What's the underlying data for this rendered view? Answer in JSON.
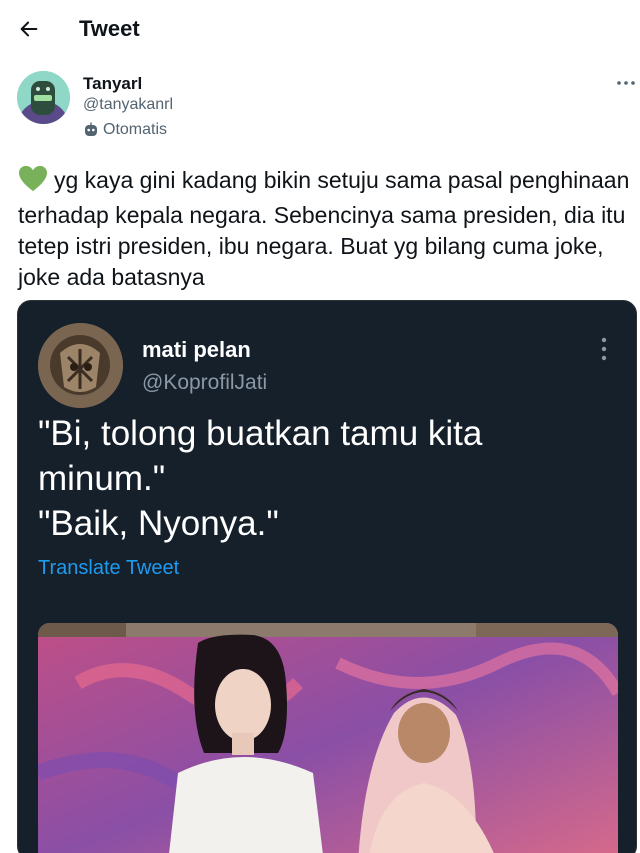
{
  "header": {
    "title": "Tweet",
    "back_icon": "arrow-left-icon"
  },
  "author": {
    "name": "Tanyarl",
    "handle": "@tanyakanrl",
    "automated_label": "Otomatis",
    "automated_icon": "robot-icon"
  },
  "tweet": {
    "emoji": "green-heart-icon",
    "text": "yg kaya gini kadang bikin setuju sama pasal penghinaan terhadap kepala negara. Sebencinya sama presiden, dia itu tetep istri presiden, ibu negara. Buat yg bilang cuma joke, joke ada batasnya"
  },
  "quoted": {
    "name": "mati pelan",
    "handle": "@KoprofilJati",
    "lines": [
      "\"Bi, tolong buatkan tamu kita",
      "minum.\"",
      "\"Baik, Nyonya.\""
    ],
    "translate_label": "Translate Tweet"
  },
  "colors": {
    "accent": "#1d9bf0",
    "card_bg": "#15202b",
    "heart": "#78b159"
  }
}
